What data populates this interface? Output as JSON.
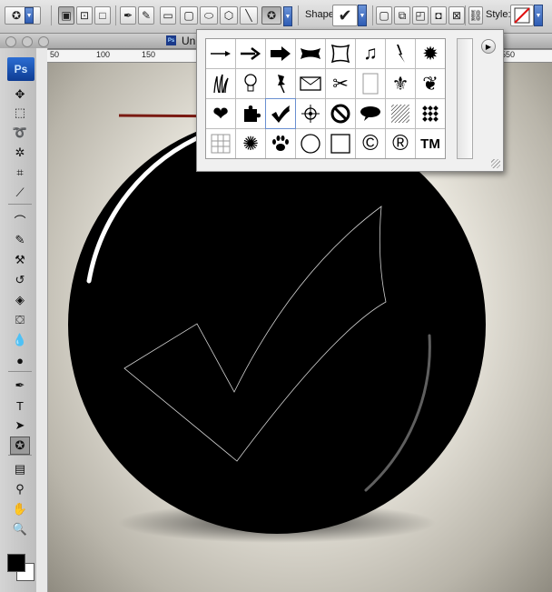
{
  "options_bar": {
    "shape_label": "Shape:",
    "style_label": "Style:",
    "shape_value": "✔"
  },
  "document": {
    "title": "Un"
  },
  "ruler": {
    "labels": [
      "50",
      "100",
      "150",
      "550"
    ]
  },
  "toolbox": {
    "logo": "Ps"
  },
  "shape_picker": {
    "rows": [
      [
        "arrow-thin",
        "arrow-medium",
        "arrow-bold",
        "banner",
        "frame",
        "music-note",
        "lightning",
        "starburst"
      ],
      [
        "grass",
        "light-bulb",
        "thumbtack",
        "envelope",
        "scissors",
        "blank-page",
        "fleur-de-lis",
        "cat-paw-ornament"
      ],
      [
        "heart",
        "puzzle-piece",
        "checkmark",
        "target",
        "no-sign",
        "speech-bubble",
        "hatched-square",
        "diamond-grid"
      ],
      [
        "grid",
        "explosion",
        "paw-print",
        "circle-frame",
        "square-frame",
        "copyright",
        "registered",
        "trademark"
      ]
    ],
    "text_symbols": {
      "copyright": "©",
      "registered": "®",
      "trademark": "TM"
    },
    "selected": "checkmark"
  },
  "colors": {
    "arrow": "#7a1a12",
    "button": "#000000",
    "highlight": "#ffffff",
    "background": "#f7f6f1",
    "foreground_swatch": "#000000",
    "background_swatch": "#ffffff"
  }
}
